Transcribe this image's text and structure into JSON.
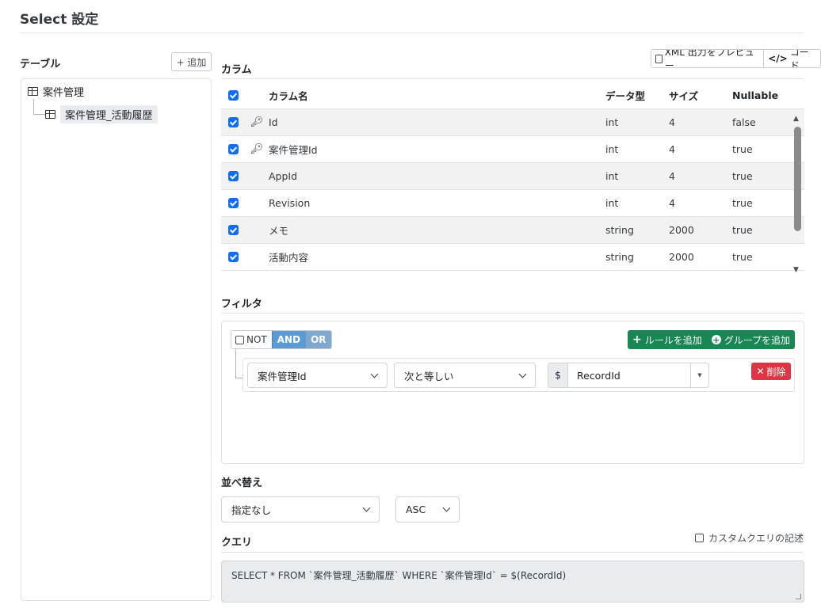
{
  "page": {
    "title": "Select 設定"
  },
  "tables_panel": {
    "label": "テーブル",
    "add_button": "+ 追加",
    "tree": {
      "root": "案件管理",
      "child": "案件管理_活動履歴"
    }
  },
  "columns": {
    "label": "カラム",
    "xml_preview_button": "XML 出力をプレビュー",
    "code_button": "コード",
    "headers": {
      "name": "カラム名",
      "type": "データ型",
      "size": "サイズ",
      "nullable": "Nullable"
    },
    "rows": [
      {
        "checked": true,
        "key": true,
        "name": "Id",
        "type": "int",
        "size": "4",
        "nullable": "false"
      },
      {
        "checked": true,
        "key": true,
        "name": "案件管理Id",
        "type": "int",
        "size": "4",
        "nullable": "true"
      },
      {
        "checked": true,
        "key": false,
        "name": "AppId",
        "type": "int",
        "size": "4",
        "nullable": "true"
      },
      {
        "checked": true,
        "key": false,
        "name": "Revision",
        "type": "int",
        "size": "4",
        "nullable": "true"
      },
      {
        "checked": true,
        "key": false,
        "name": "メモ",
        "type": "string",
        "size": "2000",
        "nullable": "true"
      },
      {
        "checked": true,
        "key": false,
        "name": "活動内容",
        "type": "string",
        "size": "2000",
        "nullable": "true"
      }
    ]
  },
  "filter": {
    "label": "フィルタ",
    "not_label": "NOT",
    "and_label": "AND",
    "or_label": "OR",
    "add_rule_button": "ルールを追加",
    "add_group_button": "グループを追加",
    "rule": {
      "field": "案件管理Id",
      "operator": "次と等しい",
      "value_prefix": "$",
      "value": "RecordId"
    },
    "delete_button": "削除"
  },
  "sort": {
    "label": "並べ替え",
    "field": "指定なし",
    "direction": "ASC"
  },
  "query": {
    "label": "クエリ",
    "custom_query_label": "カスタムクエリの記述",
    "sql": "SELECT * FROM `案件管理_活動履歴` WHERE `案件管理Id` = $(RecordId)"
  },
  "colors": {
    "primary": "#0d6efd",
    "success": "#198754",
    "danger": "#dc3545",
    "and_active": "#5b9bd5"
  }
}
